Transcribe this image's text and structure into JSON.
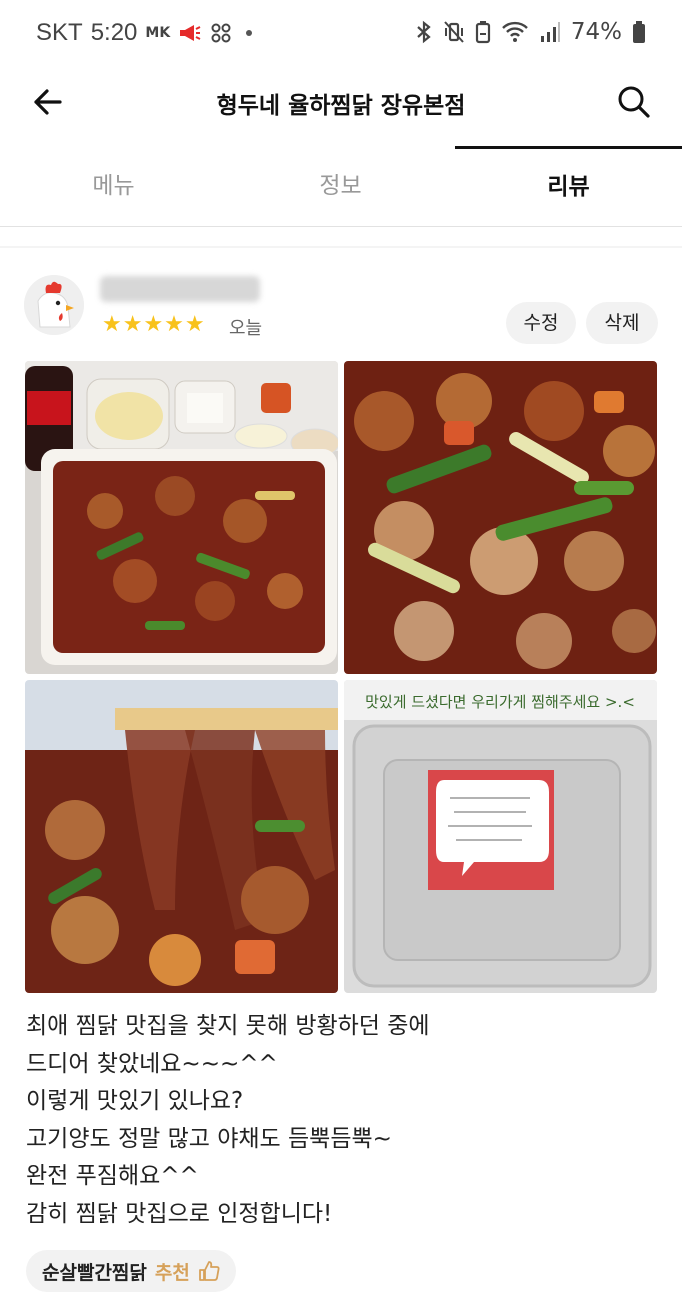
{
  "status_bar": {
    "carrier": "SKT",
    "time": "5:20",
    "news_badge": "MK",
    "battery": "74%"
  },
  "header": {
    "title": "형두네 율하찜닭 장유본점"
  },
  "tabs": [
    {
      "label": "메뉴"
    },
    {
      "label": "정보"
    },
    {
      "label": "리뷰"
    }
  ],
  "review": {
    "rating_stars": "★★★★★",
    "rating": 5,
    "date": "오늘",
    "edit_label": "수정",
    "delete_label": "삭제",
    "photo_banner": "맛있게 드셨다면 우리가게 찜해주세요 >.<",
    "lines": [
      "최애 찜닭 맛집을 찾지 못해 방황하던 중에",
      "드디어 찾았네요~~~^^",
      "이렇게 맛있기 있나요?",
      "고기양도 정말 많고 야채도 듬뿍듬뿍~",
      "완전 푸짐해요^^",
      "감히 찜닭 맛집으로 인정합니다!"
    ],
    "menu_tag": "순살빨간찜닭",
    "recommend_label": "추천"
  },
  "colors": {
    "star": "#f8c21c",
    "active_tab": "#111111",
    "recommend": "#d6a15a"
  }
}
